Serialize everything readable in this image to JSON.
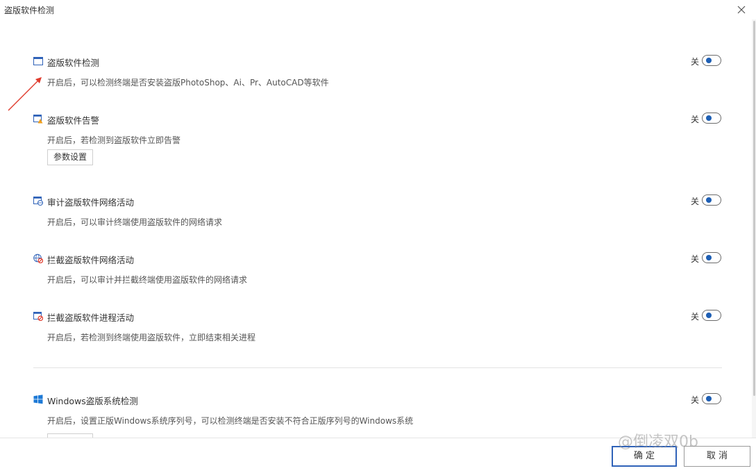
{
  "window": {
    "title": "盗版软件检测"
  },
  "settings": [
    {
      "icon": "window-icon",
      "title": "盗版软件检测",
      "description": "开启后，可以检测终端是否安装盗版PhotoShop、Ai、Pr、AutoCAD等软件",
      "toggle_label": "关",
      "enabled": false
    },
    {
      "icon": "window-alert-icon",
      "title": "盗版软件告警",
      "description": "开启后，若检测到盗版软件立即告警",
      "toggle_label": "关",
      "enabled": false,
      "button_label": "参数设置"
    },
    {
      "icon": "window-network-icon",
      "title": "审计盗版软件网络活动",
      "description": "开启后，可以审计终端使用盗版软件的网络请求",
      "toggle_label": "关",
      "enabled": false
    },
    {
      "icon": "globe-block-icon",
      "title": "拦截盗版软件网络活动",
      "description": "开启后，可以审计并拦截终端使用盗版软件的网络请求",
      "toggle_label": "关",
      "enabled": false
    },
    {
      "icon": "window-block-icon",
      "title": "拦截盗版软件进程活动",
      "description": "开启后，若检测到终端使用盗版软件，立即结束相关进程",
      "toggle_label": "关",
      "enabled": false
    },
    {
      "icon": "windows-logo-icon",
      "title": "Windows盗版系统检测",
      "description": "开启后，设置正版Windows系统序列号，可以检测终端是否安装不符合正版序列号的Windows系统",
      "toggle_label": "关",
      "enabled": false
    }
  ],
  "footer": {
    "confirm_label": "确 定",
    "cancel_label": "取 消"
  },
  "watermark": "@倒凌双0b",
  "colors": {
    "accent": "#1e5fb4",
    "primary_border": "#2f62b8",
    "arrow": "#e03c2e"
  }
}
